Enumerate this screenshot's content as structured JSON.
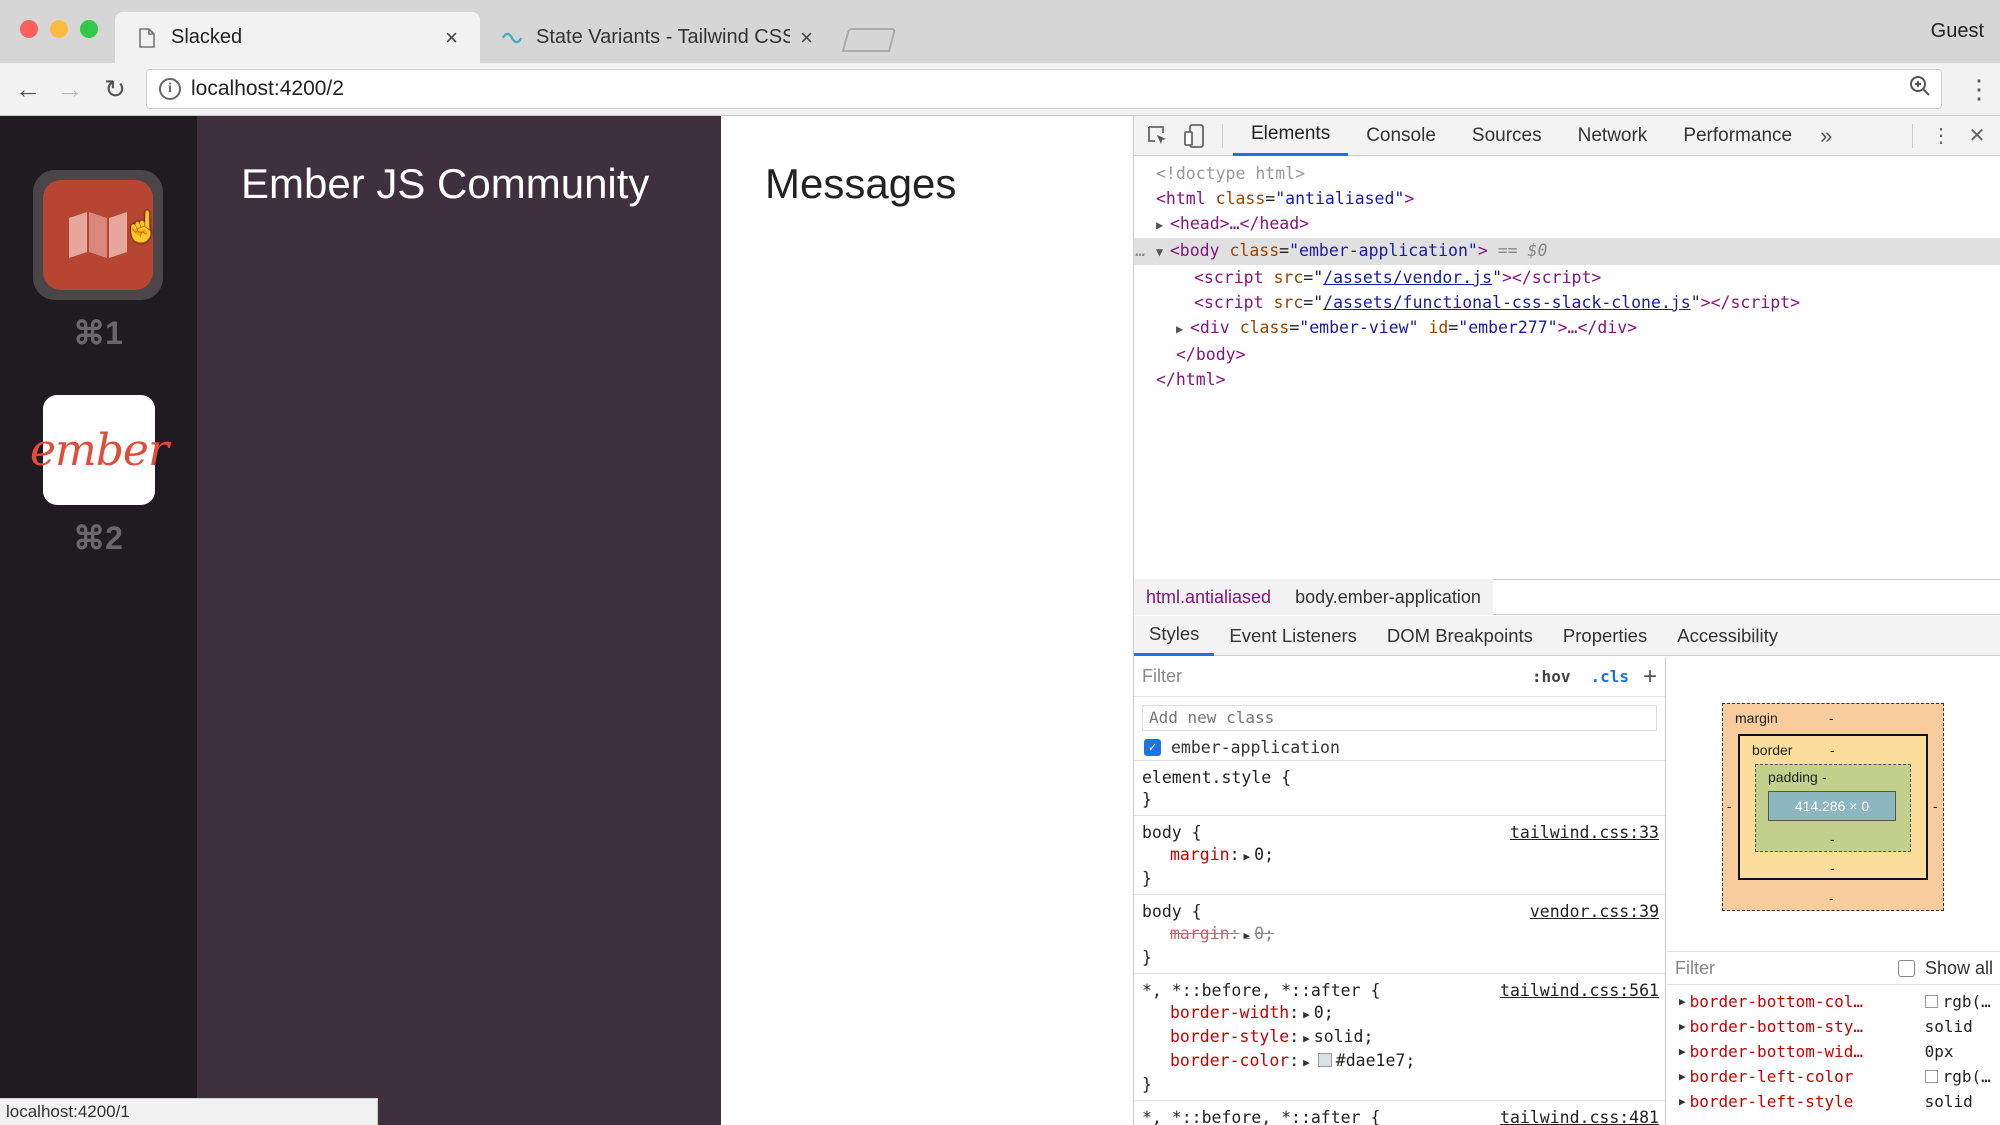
{
  "browser": {
    "tabs": [
      {
        "title": "Slacked",
        "close": "×"
      },
      {
        "title": "State Variants - Tailwind CSS",
        "close": "×"
      }
    ],
    "profile": "Guest",
    "url": "localhost:4200/2",
    "status_url": "localhost:4200/1"
  },
  "teams": [
    {
      "name": "map",
      "shortcut": "⌘1"
    },
    {
      "name": "ember",
      "logo_text": "ember",
      "shortcut": "⌘2"
    }
  ],
  "channel_sidebar": {
    "team_name": "Ember JS Community"
  },
  "messages": {
    "title": "Messages"
  },
  "devtools": {
    "tabs": [
      "Elements",
      "Console",
      "Sources",
      "Network",
      "Performance"
    ],
    "more": "»",
    "dom": {
      "doctype": "<!doctype html>",
      "html_open": {
        "tag": "<html",
        "attr": "class",
        "val": "\"antialiased\"",
        "end": ">"
      },
      "head": "<head>…</head>",
      "body_open": {
        "tag": "<body",
        "attr": "class",
        "val": "\"ember-application\"",
        "end": ">",
        "ref": " == $0"
      },
      "script1": {
        "src": "/assets/vendor.js"
      },
      "script2": {
        "src": "/assets/functional-css-slack-clone.js"
      },
      "div": {
        "class": "\"ember-view\"",
        "id": "\"ember277\"",
        "rest": ">…</div>"
      },
      "body_close": "</body>",
      "html_close": "</html>"
    },
    "breadcrumbs": [
      "html.antialiased",
      "body.ember-application"
    ],
    "subtabs": [
      "Styles",
      "Event Listeners",
      "DOM Breakpoints",
      "Properties",
      "Accessibility"
    ],
    "styles": {
      "filter_placeholder": "Filter",
      "hov": ":hov",
      "cls": ".cls",
      "add_class_placeholder": "Add new class",
      "class_name": "ember-application",
      "element_style": "element.style {",
      "rules": [
        {
          "selector": "body {",
          "source": "tailwind.css:33",
          "decls": [
            {
              "prop": "margin",
              "val": "0;"
            }
          ],
          "struck": false
        },
        {
          "selector": "body {",
          "source": "vendor.css:39",
          "decls": [
            {
              "prop": "margin",
              "val": "0;"
            }
          ],
          "struck": true
        },
        {
          "selector": "*, *::before, *::after {",
          "source": "tailwind.css:561",
          "decls": [
            {
              "prop": "border-width",
              "val": "0;"
            },
            {
              "prop": "border-style",
              "val": "solid;"
            },
            {
              "prop": "border-color",
              "val": "#dae1e7;"
            }
          ],
          "struck": false
        },
        {
          "selector": "*, *::before, *::after {",
          "source": "tailwind.css:481",
          "decls": [],
          "struck": false
        }
      ],
      "close_brace": "}"
    },
    "box_model": {
      "margin": "margin",
      "border": "border",
      "padding": "padding",
      "dash": "-",
      "content": "414.286 × 0"
    },
    "computed": {
      "filter_placeholder": "Filter",
      "show_all": "Show all",
      "rows": [
        {
          "prop": "border-bottom-col…",
          "val": "rgb(…",
          "swatch": true
        },
        {
          "prop": "border-bottom-sty…",
          "val": "solid",
          "swatch": false
        },
        {
          "prop": "border-bottom-wid…",
          "val": "0px",
          "swatch": false
        },
        {
          "prop": "border-left-color",
          "val": "rgb(…",
          "swatch": true
        },
        {
          "prop": "border-left-style",
          "val": "solid",
          "swatch": false
        }
      ]
    }
  }
}
